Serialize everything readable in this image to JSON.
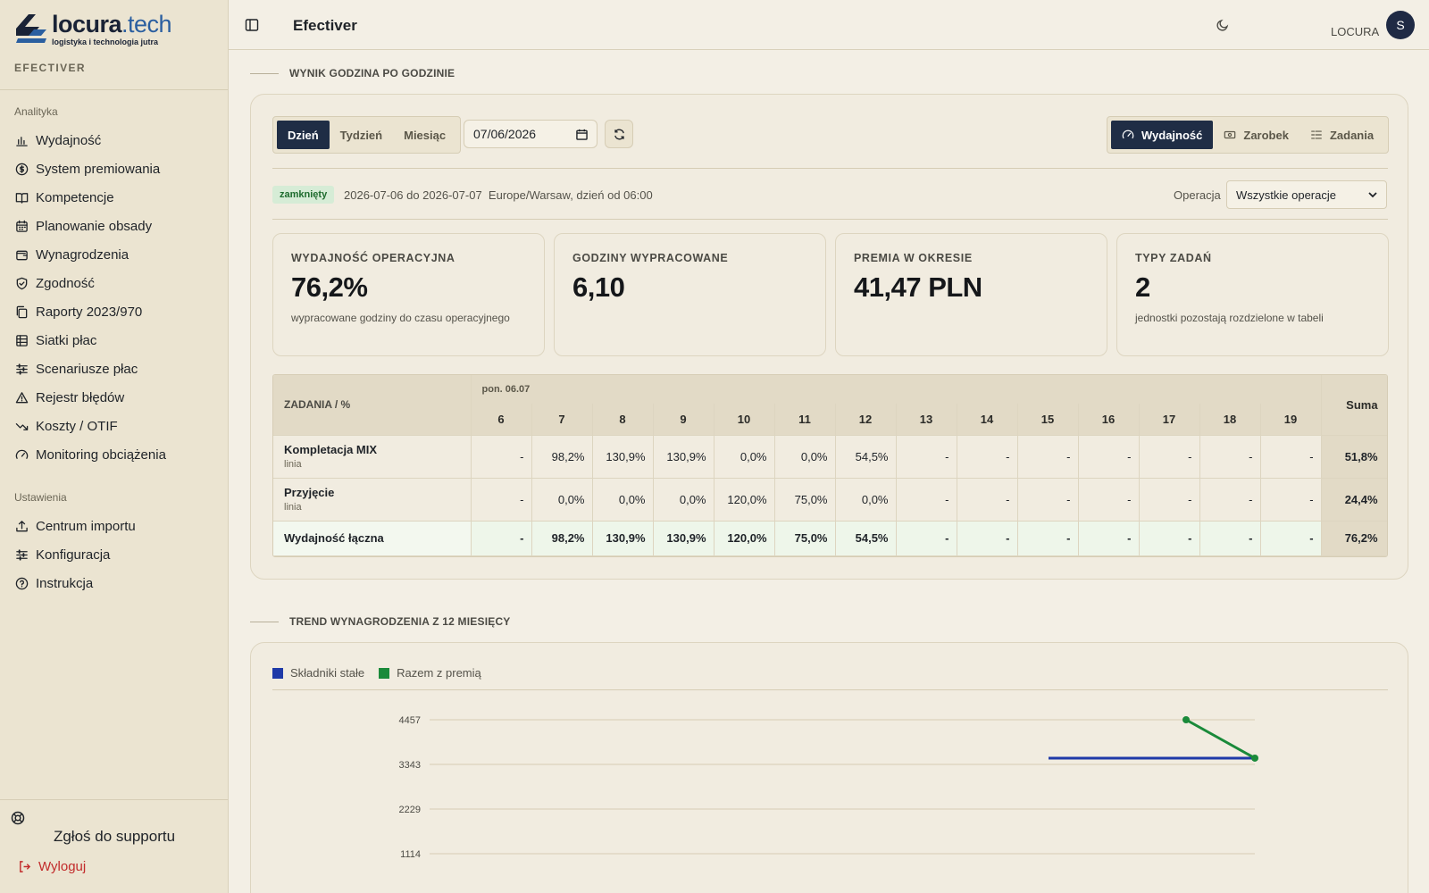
{
  "brand": {
    "name": "locura",
    "tld": ".tech",
    "tagline": "logistyka i technologia jutra",
    "caption": "EFECTIVER"
  },
  "sidebar": {
    "section_analytics": "Analityka",
    "analytics_items": [
      {
        "label": "Wydajność",
        "icon": "bar-chart-icon"
      },
      {
        "label": "System premiowania",
        "icon": "dollar-circle-icon"
      },
      {
        "label": "Kompetencje",
        "icon": "book-icon"
      },
      {
        "label": "Planowanie obsady",
        "icon": "calendar-icon"
      },
      {
        "label": "Wynagrodzenia",
        "icon": "wallet-icon"
      },
      {
        "label": "Zgodność",
        "icon": "shield-check-icon"
      },
      {
        "label": "Raporty 2023/970",
        "icon": "files-icon"
      },
      {
        "label": "Siatki płac",
        "icon": "table-icon"
      },
      {
        "label": "Scenariusze płac",
        "icon": "sliders-icon"
      },
      {
        "label": "Rejestr błędów",
        "icon": "warning-icon"
      },
      {
        "label": "Koszty / OTIF",
        "icon": "trend-down-icon"
      },
      {
        "label": "Monitoring obciążenia",
        "icon": "gauge-icon"
      }
    ],
    "section_settings": "Ustawienia",
    "settings_items": [
      {
        "label": "Centrum importu",
        "icon": "upload-icon"
      },
      {
        "label": "Konfiguracja",
        "icon": "sliders-icon"
      },
      {
        "label": "Instrukcja",
        "icon": "help-circle-icon"
      }
    ],
    "support": "Zgłoś do supportu",
    "logout": "Wyloguj"
  },
  "header": {
    "title": "Efectiver",
    "user": "LOCURA",
    "avatar_initial": "S"
  },
  "hourly": {
    "section_title": "WYNIK GODZINA PO GODZINIE",
    "periods": [
      "Dzień",
      "Tydzień",
      "Miesiąc"
    ],
    "active_period": "Dzień",
    "date": "07/06/2026",
    "modes": [
      {
        "label": "Wydajność",
        "icon": "gauge-icon"
      },
      {
        "label": "Zarobek",
        "icon": "banknote-icon"
      },
      {
        "label": "Zadania",
        "icon": "list-icon"
      }
    ],
    "status": "zamknięty",
    "range": "2026-07-06 do 2026-07-07",
    "timezone_note": "Europe/Warsaw, dzień od 06:00",
    "operation_label": "Operacja",
    "operation_value": "Wszystkie operacje",
    "kpis": [
      {
        "title": "WYDAJNOŚĆ OPERACYJNA",
        "value": "76,2%",
        "note": "wypracowane godziny do czasu operacyjnego"
      },
      {
        "title": "GODZINY WYPRACOWANE",
        "value": "6,10",
        "note": ""
      },
      {
        "title": "PREMIA W OKRESIE",
        "value": "41,47 PLN",
        "note": ""
      },
      {
        "title": "TYPY ZADAŃ",
        "value": "2",
        "note": "jednostki pozostają rozdzielone w tabeli"
      }
    ],
    "table": {
      "task_header": "ZADANIA / %",
      "day_label": "pon. 06.07",
      "hours": [
        "6",
        "7",
        "8",
        "9",
        "10",
        "11",
        "12",
        "13",
        "14",
        "15",
        "16",
        "17",
        "18",
        "19"
      ],
      "sum_header": "Suma",
      "rows": [
        {
          "name": "Kompletacja MIX",
          "sub": "linia",
          "values": [
            "-",
            "98,2%",
            "130,9%",
            "130,9%",
            "0,0%",
            "0,0%",
            "54,5%",
            "-",
            "-",
            "-",
            "-",
            "-",
            "-",
            "-"
          ],
          "sum": "51,8%"
        },
        {
          "name": "Przyjęcie",
          "sub": "linia",
          "values": [
            "-",
            "0,0%",
            "0,0%",
            "0,0%",
            "120,0%",
            "75,0%",
            "0,0%",
            "-",
            "-",
            "-",
            "-",
            "-",
            "-",
            "-"
          ],
          "sum": "24,4%"
        }
      ],
      "total": {
        "name": "Wydajność łączna",
        "values": [
          "-",
          "98,2%",
          "130,9%",
          "130,9%",
          "120,0%",
          "75,0%",
          "54,5%",
          "-",
          "-",
          "-",
          "-",
          "-",
          "-",
          "-"
        ],
        "sum": "76,2%"
      }
    }
  },
  "trend": {
    "section_title": "TREND WYNAGRODZENIA Z 12 MIESIĘCY"
  },
  "chart_data": {
    "type": "line",
    "title": "",
    "xlabel": "",
    "ylabel": "",
    "y_ticks": [
      4457,
      3343,
      2229,
      1114
    ],
    "ylim": [
      0,
      4457
    ],
    "legend_position": "top-left",
    "series": [
      {
        "name": "Składniki stałe",
        "color": "#1f3aa8",
        "points": [
          {
            "x": 9.0,
            "y": 3500
          },
          {
            "x": 12,
            "y": 3500
          }
        ]
      },
      {
        "name": "Razem z premią",
        "color": "#1a8a3a",
        "points": [
          {
            "x": 11,
            "y": 4457
          },
          {
            "x": 12,
            "y": 3500
          }
        ]
      }
    ],
    "x_range": [
      0,
      12
    ],
    "grid": true
  },
  "colors": {
    "primary": "#1f2d45",
    "danger": "#c22b2b",
    "status_ok": "#1d6b2d"
  }
}
